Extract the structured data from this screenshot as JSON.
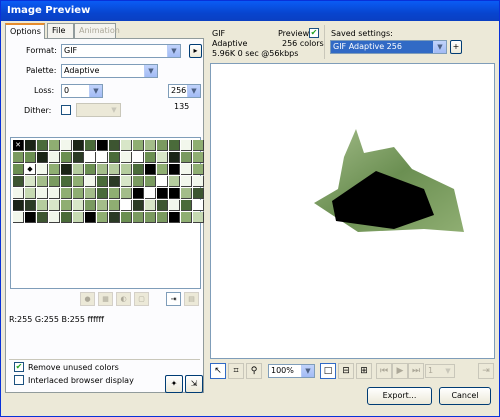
{
  "window": {
    "title": "Image Preview"
  },
  "tabs": [
    {
      "label": "Options",
      "active": true
    },
    {
      "label": "File",
      "active": false
    },
    {
      "label": "Animation",
      "active": false,
      "disabled": true
    }
  ],
  "options": {
    "format_label": "Format:",
    "format_value": "GIF",
    "palette_label": "Palette:",
    "palette_value": "Adaptive",
    "loss_label": "Loss:",
    "loss_value": "0",
    "colors_value": "256",
    "colors_count": "135",
    "dither_label": "Dither:",
    "dither_checked": false,
    "pixel_info": "R:255 G:255 B:255 ffffff",
    "remove_unused_label": "Remove unused colors",
    "remove_unused_checked": true,
    "interlaced_label": "Interlaced browser display",
    "interlaced_checked": false
  },
  "preview": {
    "format": "GIF",
    "palette": "Adaptive",
    "size_info": "5.96K  0 sec @56kbps",
    "preview_label": "Preview",
    "preview_checked": true,
    "colors_info": "256 colors",
    "saved_settings_label": "Saved settings:",
    "saved_settings_value": "GIF Adaptive 256",
    "zoom_value": "100%",
    "frame_value": "1"
  },
  "buttons": {
    "export": "Export...",
    "cancel": "Cancel"
  },
  "colors": {
    "title_bar": "#0845cf",
    "selection": "#316ac5",
    "swatch_palette": [
      "#2b3a25",
      "#4a6b3a",
      "#6b8f52",
      "#8fae72",
      "#b5cc9e",
      "#d8e6c8",
      "#f2f7ec",
      "#1a2416",
      "#3d5531",
      "#7a9a60",
      "#a4bd8a",
      "#c6d9b2",
      "#000000",
      "#ffffff"
    ]
  }
}
